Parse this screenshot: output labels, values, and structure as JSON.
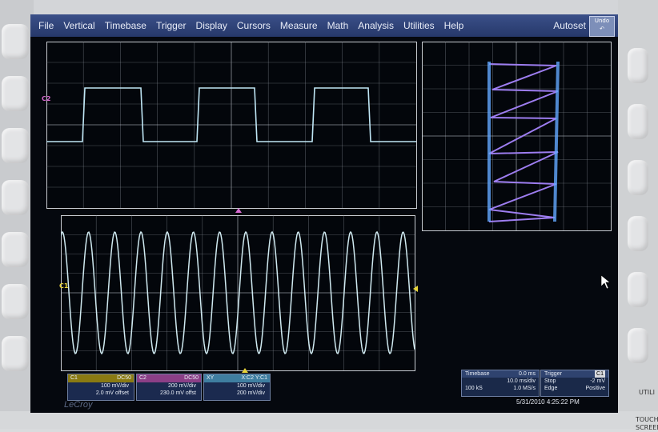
{
  "menu": [
    "File",
    "Vertical",
    "Timebase",
    "Trigger",
    "Display",
    "Cursors",
    "Measure",
    "Math",
    "Analysis",
    "Utilities",
    "Help"
  ],
  "autoset_label": "Autoset",
  "undo_label": "Undo",
  "channels": {
    "c2_marker": "C2",
    "c1_marker": "C1"
  },
  "descriptors": {
    "c1": {
      "name": "C1",
      "coupling": "DC50",
      "scale": "100 mV/div",
      "offset": "2.0 mV offset",
      "color": "#e7d43a"
    },
    "c2": {
      "name": "C2",
      "coupling": "DC50",
      "scale": "200 mV/div",
      "offset": "230.0 mV offst",
      "color": "#d66ad0"
    },
    "xy": {
      "name": "XY",
      "source": "X:C2 Y:C1",
      "scale_x": "100 mV/div",
      "scale_y": "200 mV/div",
      "color": "#7fc6e6"
    }
  },
  "timebase": {
    "label": "Timebase",
    "delay": "0.0 ms",
    "scale": "10.0 ms/div",
    "samples": "100 kS",
    "rate": "1.0 MS/s"
  },
  "trigger": {
    "label": "Trigger",
    "channel": "C1",
    "mode": "Stop",
    "level": "-2 mV",
    "type": "Edge",
    "slope": "Positive"
  },
  "datetime": "5/31/2010 4:25:22 PM",
  "brand": "LeCroy",
  "touch_label": "TOUCH SCREEN",
  "utili_label": "UTILI",
  "colors": {
    "trace_c1": "#cfe9f0",
    "trace_c2": "#bfe6f5",
    "xy_trace": "#9d7df0",
    "xy_v": "#63a8ff"
  }
}
